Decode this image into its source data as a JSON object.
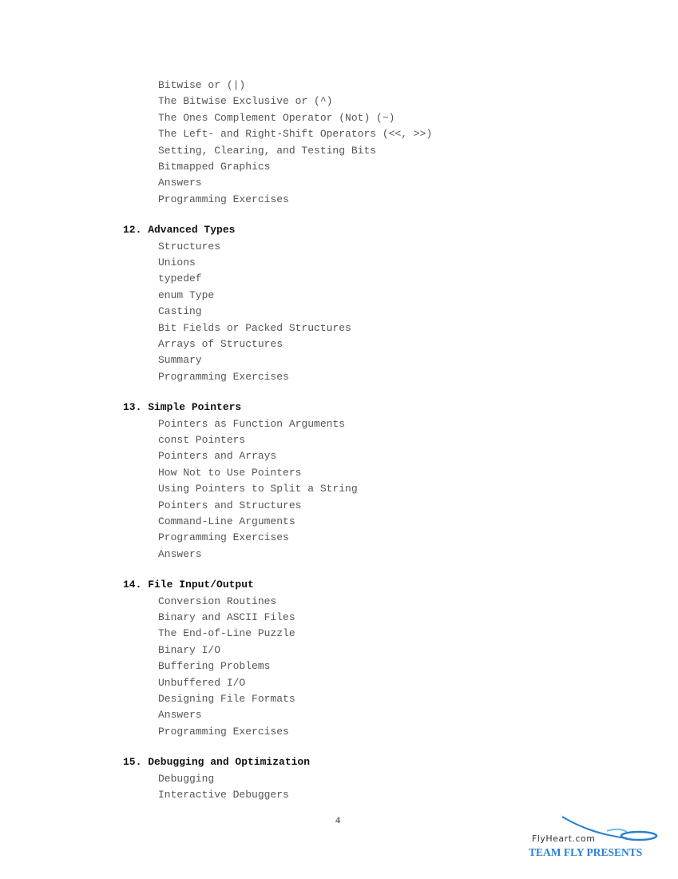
{
  "document": {
    "page_number": "4",
    "sections": [
      {
        "heading": null,
        "items": [
          "Bitwise or (|)",
          "The Bitwise Exclusive or (^)",
          "The Ones Complement Operator (Not) (~)",
          "The Left- and Right-Shift Operators (<<, >>)",
          "Setting, Clearing, and Testing Bits",
          "Bitmapped Graphics",
          "Answers",
          "Programming Exercises"
        ]
      },
      {
        "heading": "12. Advanced Types",
        "items": [
          "Structures",
          "Unions",
          "typedef",
          "enum Type",
          "Casting",
          "Bit Fields or Packed Structures",
          "Arrays of Structures",
          "Summary",
          "Programming Exercises"
        ]
      },
      {
        "heading": "13. Simple Pointers",
        "items": [
          "Pointers as Function Arguments",
          "const Pointers",
          "Pointers and Arrays",
          "How Not to Use Pointers",
          "Using Pointers to Split a String",
          "Pointers and Structures",
          "Command-Line Arguments",
          "Programming Exercises",
          "Answers"
        ]
      },
      {
        "heading": "14. File Input/Output",
        "items": [
          "Conversion Routines",
          "Binary and ASCII Files",
          "The End-of-Line Puzzle",
          "Binary I/O",
          "Buffering Problems",
          "Unbuffered I/O",
          "Designing File Formats",
          "Answers",
          "Programming Exercises"
        ]
      },
      {
        "heading": "15. Debugging and Optimization",
        "items": [
          "Debugging",
          "Interactive Debuggers"
        ]
      }
    ]
  },
  "logo": {
    "site": "FlyHeart.com",
    "tagline": "TEAM FLY PRESENTS",
    "tagline_color": "#2a7fd4",
    "swoosh_color": "#3a9be0"
  }
}
